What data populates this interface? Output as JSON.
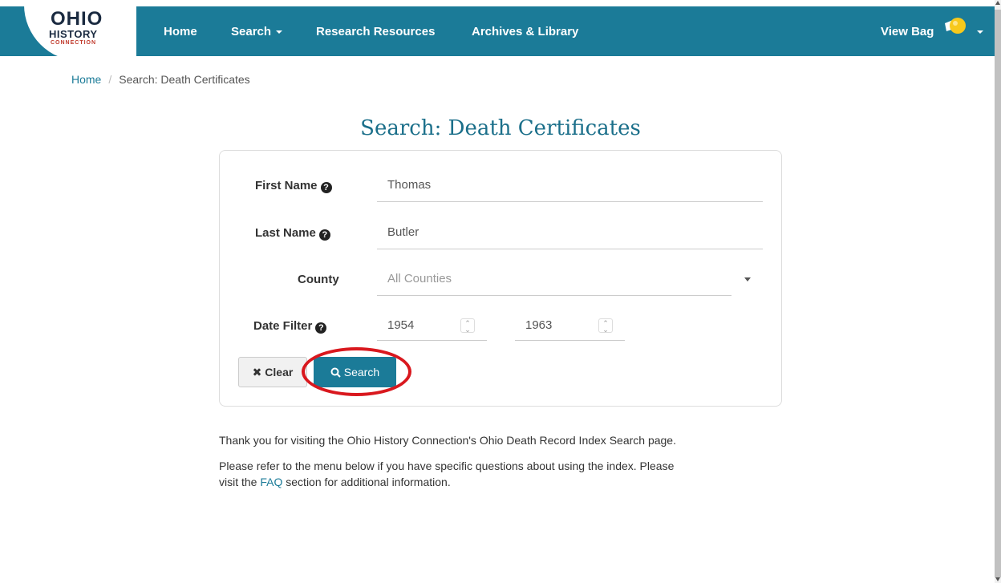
{
  "header": {
    "logo_line1": "OHIO",
    "logo_line2": "HISTORY",
    "logo_line3": "CONNECTION",
    "nav": {
      "home": "Home",
      "search": "Search",
      "research": "Research Resources",
      "archives": "Archives & Library"
    },
    "view_bag": "View Bag"
  },
  "breadcrumb": {
    "home": "Home",
    "separator": "/",
    "current": "Search: Death Certificates"
  },
  "page_title": "Search: Death Certificates",
  "form": {
    "first_name_label": "First Name",
    "first_name_value": "Thomas",
    "last_name_label": "Last Name",
    "last_name_value": "Butler",
    "county_label": "County",
    "county_value": "All Counties",
    "date_filter_label": "Date Filter",
    "date_from": "1954",
    "date_to": "1963",
    "clear_label": "Clear",
    "search_label": "Search"
  },
  "content": {
    "para1": "Thank you for visiting the Ohio History Connection's Ohio Death Record Index Search page.",
    "para2_line1": "Please refer to the menu below if you have specific questions about using the index. Please",
    "para2_visit": "visit the",
    "para2_link": "FAQ",
    "para2_end": "section for additional information."
  },
  "colors": {
    "brand": "#1b7b98",
    "highlight_ring": "#d9181e"
  }
}
